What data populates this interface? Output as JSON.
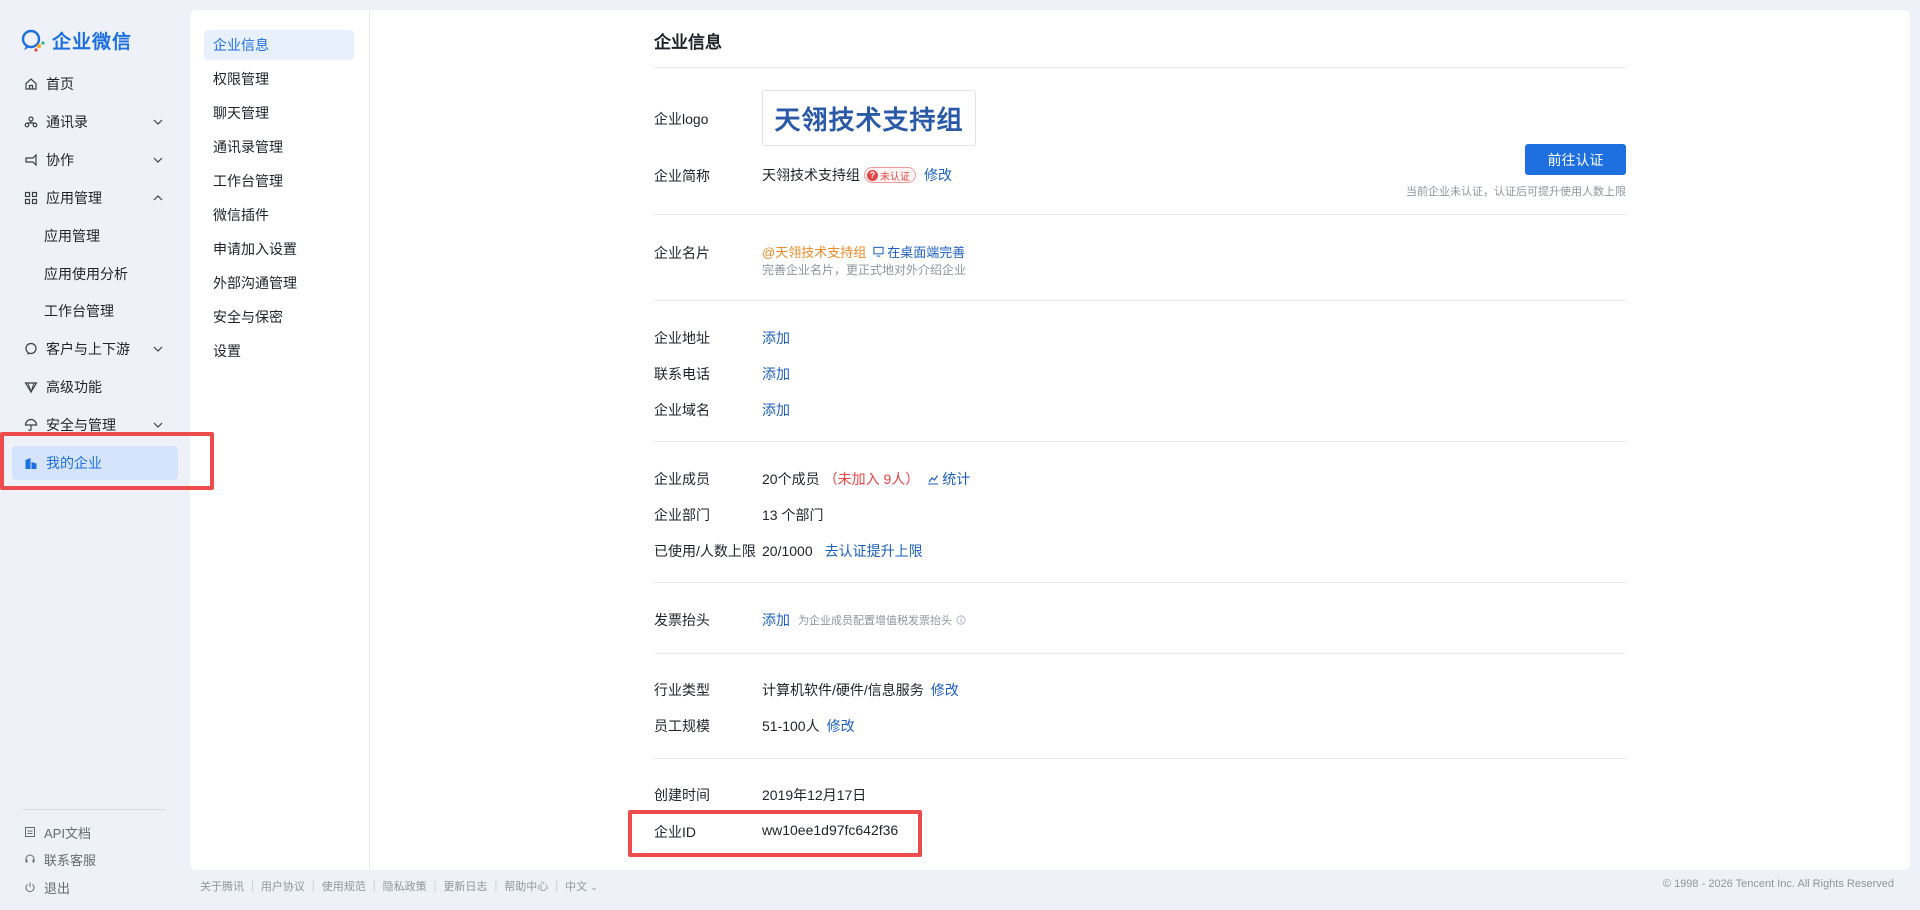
{
  "app": {
    "brand": "企业微信"
  },
  "sidebar": {
    "items": [
      {
        "label": "首页",
        "icon": "home-icon"
      },
      {
        "label": "通讯录",
        "icon": "contacts-icon"
      },
      {
        "label": "协作",
        "icon": "collaboration-icon"
      },
      {
        "label": "应用管理",
        "icon": "apps-icon"
      },
      {
        "label": "应用管理"
      },
      {
        "label": "应用使用分析"
      },
      {
        "label": "工作台管理"
      },
      {
        "label": "客户与上下游",
        "icon": "chat-bubble-icon"
      },
      {
        "label": "高级功能",
        "icon": "diamond-icon"
      },
      {
        "label": "安全与管理",
        "icon": "umbrella-icon"
      },
      {
        "label": "我的企业",
        "icon": "building-icon"
      }
    ],
    "footer": [
      {
        "label": "API文档",
        "icon": "doc-icon"
      },
      {
        "label": "联系客服",
        "icon": "headset-icon"
      },
      {
        "label": "退出",
        "icon": "power-icon"
      }
    ]
  },
  "subnav": {
    "items": [
      {
        "label": "企业信息"
      },
      {
        "label": "权限管理"
      },
      {
        "label": "聊天管理"
      },
      {
        "label": "通讯录管理"
      },
      {
        "label": "工作台管理"
      },
      {
        "label": "微信插件"
      },
      {
        "label": "申请加入设置"
      },
      {
        "label": "外部沟通管理"
      },
      {
        "label": "安全与保密"
      },
      {
        "label": "设置"
      }
    ]
  },
  "main": {
    "title": "企业信息",
    "logo": {
      "label": "企业logo",
      "text": "天翎技术支持组"
    },
    "short_name": {
      "label": "企业简称",
      "value": "天翎技术支持组",
      "badge": "未认证",
      "action": "修改"
    },
    "verify": {
      "button": "前往认证",
      "hint": "当前企业未认证，认证后可提升使用人数上限"
    },
    "card": {
      "label": "企业名片",
      "value": "@天翎技术支持组",
      "action": "在桌面端完善",
      "hint": "完善企业名片，更正式地对外介绍企业"
    },
    "address": {
      "label": "企业地址",
      "action": "添加"
    },
    "phone": {
      "label": "联系电话",
      "action": "添加"
    },
    "domain": {
      "label": "企业域名",
      "action": "添加"
    },
    "members": {
      "label": "企业成员",
      "value": "20个成员",
      "not_joined": "（未加入 9人）",
      "action": "统计"
    },
    "departments": {
      "label": "企业部门",
      "value": "13 个部门"
    },
    "limit": {
      "label": "已使用/人数上限",
      "value": "20/1000",
      "action": "去认证提升上限"
    },
    "invoice": {
      "label": "发票抬头",
      "action": "添加",
      "hint": "为企业成员配置增值税发票抬头"
    },
    "industry": {
      "label": "行业类型",
      "value": "计算机软件/硬件/信息服务",
      "action": "修改"
    },
    "staff": {
      "label": "员工规模",
      "value": "51-100人",
      "action": "修改"
    },
    "created": {
      "label": "创建时间",
      "value": "2019年12月17日"
    },
    "corp_id": {
      "label": "企业ID",
      "value": "ww10ee1d97fc642f36"
    }
  },
  "footer": {
    "links": [
      "关于腾讯",
      "用户协议",
      "使用规范",
      "隐私政策",
      "更新日志",
      "帮助中心",
      "中文"
    ],
    "copyright": "© 1998 - 2026 Tencent Inc. All Rights Reserved"
  },
  "colors": {
    "accent": "#1e6fe0",
    "link": "#1d5fbf",
    "highlight_box": "#ee4c4c",
    "warning": "#e54545",
    "orange": "#f08a24"
  }
}
